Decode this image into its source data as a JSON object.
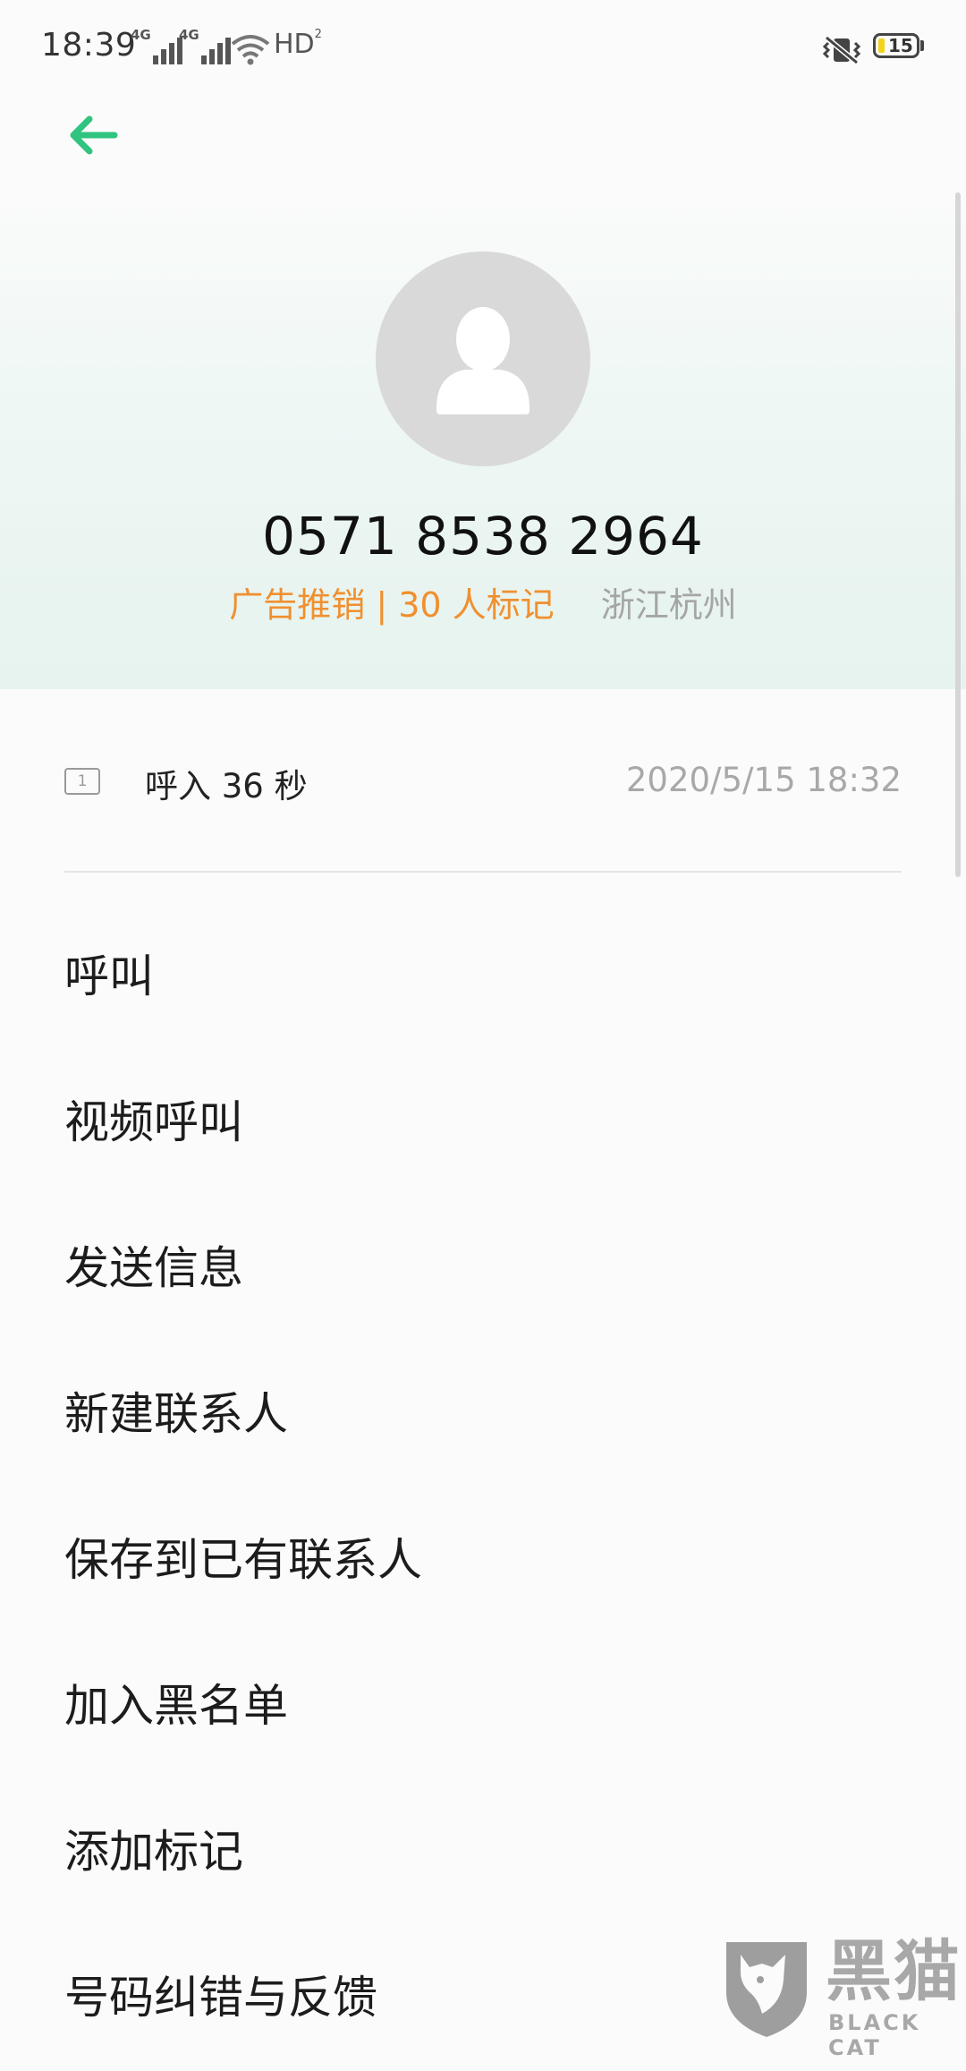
{
  "status_bar": {
    "time": "18:39",
    "signal_1": "4G",
    "signal_2": "4G",
    "hd": "HD",
    "hd_sub": "2",
    "battery": "15"
  },
  "contact": {
    "number": "0571 8538 2964",
    "tag": "广告推销 | 30 人标记",
    "location": "浙江杭州"
  },
  "call_record": {
    "sim": "1",
    "type": "呼入  36 秒",
    "time": "2020/5/15 18:32"
  },
  "actions": [
    "呼叫",
    "视频呼叫",
    "发送信息",
    "新建联系人",
    "保存到已有联系人",
    "加入黑名单",
    "添加标记",
    "号码纠错与反馈"
  ],
  "watermark": {
    "logo": "黑猫",
    "sub": "BLACK CAT"
  },
  "colors": {
    "accent": "#2fc47f",
    "tag": "#f0902f",
    "location": "#a5a5a5"
  }
}
